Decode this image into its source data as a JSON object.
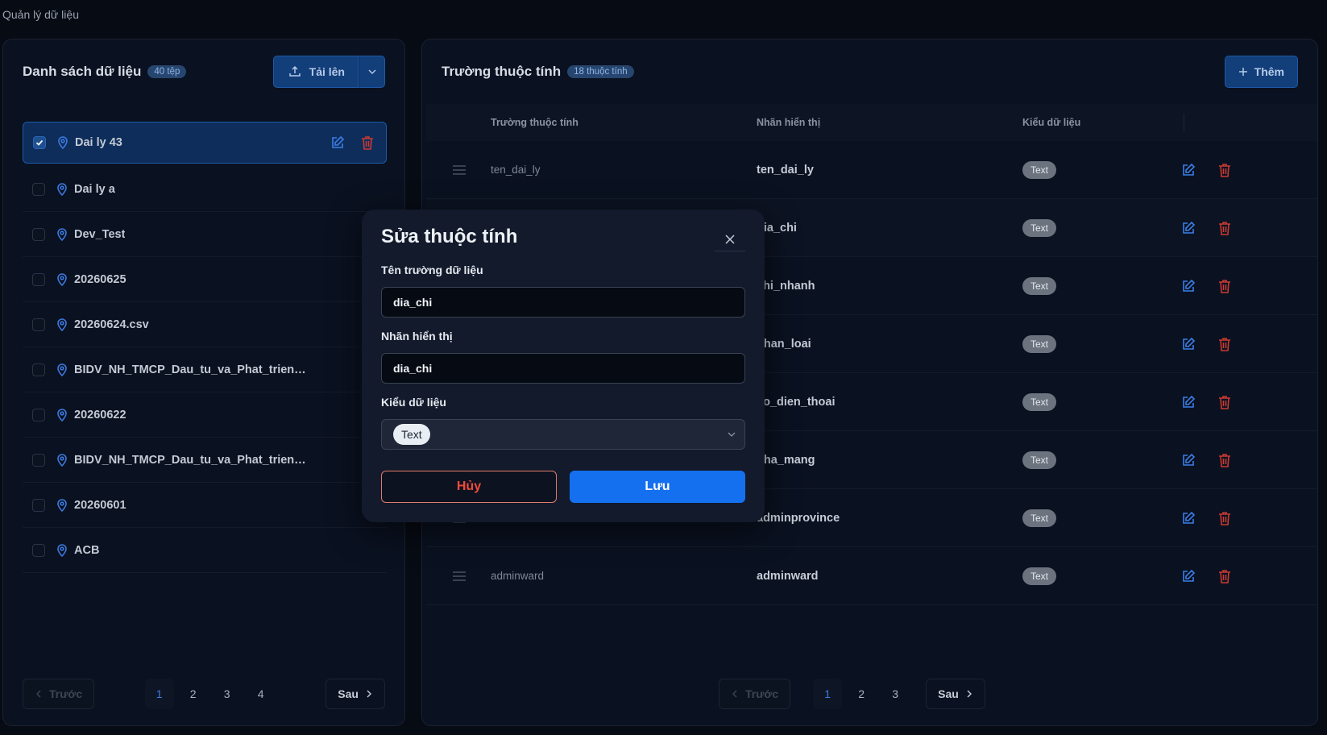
{
  "page": {
    "title": "Quản lý dữ liệu"
  },
  "left_panel": {
    "title": "Danh sách dữ liệu",
    "badge": "40 tệp",
    "upload_label": "Tải lên",
    "files": [
      {
        "name": "Dai ly 43",
        "selected": true
      },
      {
        "name": "Dai ly a",
        "selected": false
      },
      {
        "name": "Dev_Test",
        "selected": false
      },
      {
        "name": "20260625",
        "selected": false
      },
      {
        "name": "20260624.csv",
        "selected": false
      },
      {
        "name": "BIDV_NH_TMCP_Dau_tu_va_Phat_trien_Vi...",
        "selected": false
      },
      {
        "name": "20260622",
        "selected": false
      },
      {
        "name": "BIDV_NH_TMCP_Dau_tu_va_Phat_trien_Vi...",
        "selected": false
      },
      {
        "name": "20260601",
        "selected": false
      },
      {
        "name": "ACB",
        "selected": false
      }
    ],
    "pagination": {
      "prev": "Trước",
      "next": "Sau",
      "pages": [
        "1",
        "2",
        "3",
        "4"
      ],
      "active": "1"
    }
  },
  "right_panel": {
    "title": "Trường thuộc tính",
    "badge": "18 thuộc tính",
    "add_label": "Thêm",
    "columns": [
      "Trường thuộc tính",
      "Nhãn hiển thị",
      "Kiểu dữ liệu"
    ],
    "rows": [
      {
        "field": "ten_dai_ly",
        "label": "ten_dai_ly",
        "type": "Text"
      },
      {
        "field": "",
        "label": "dia_chi",
        "type": "Text"
      },
      {
        "field": "",
        "label": "chi_nhanh",
        "type": "Text"
      },
      {
        "field": "",
        "label": "phan_loai",
        "type": "Text"
      },
      {
        "field": "",
        "label": "so_dien_thoai",
        "type": "Text"
      },
      {
        "field": "",
        "label": "nha_mang",
        "type": "Text"
      },
      {
        "field": "",
        "label": "adminprovince",
        "type": "Text"
      },
      {
        "field": "adminward",
        "label": "adminward",
        "type": "Text"
      }
    ],
    "pagination": {
      "prev": "Trước",
      "next": "Sau",
      "pages": [
        "1",
        "2",
        "3"
      ],
      "active": "1"
    }
  },
  "modal": {
    "title": "Sửa thuộc tính",
    "field_name_label": "Tên trường dữ liệu",
    "field_name_value": "dia_chi",
    "display_label_label": "Nhãn hiển thị",
    "display_label_value": "dia_chi",
    "data_type_label": "Kiểu dữ liệu",
    "data_type_value": "Text",
    "cancel_label": "Hủy",
    "save_label": "Lưu"
  },
  "colors": {
    "accent": "#1570ef",
    "danger": "#ef4a3c",
    "background": "#070b14"
  },
  "icons": {
    "upload": "upload-icon",
    "pin": "map-pin-icon",
    "edit": "edit-icon",
    "delete": "trash-icon",
    "drag": "drag-handle-icon",
    "close": "close-icon",
    "caret": "chevron-down-icon",
    "plus": "plus-icon"
  }
}
